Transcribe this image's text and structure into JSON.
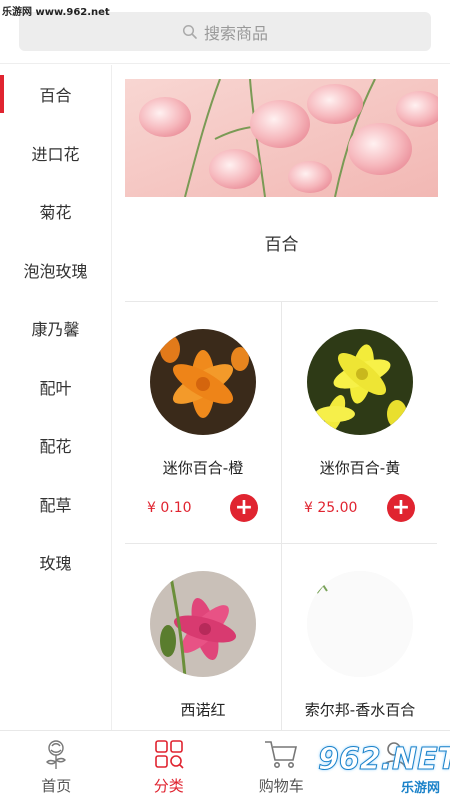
{
  "watermark": {
    "top_left": "乐游网 www.962.net",
    "bottom_right": "962.NET",
    "bottom_right_sub": "乐游网"
  },
  "search": {
    "placeholder": "搜索商品",
    "icon": "search-icon"
  },
  "sidebar": {
    "active_index": 0,
    "items": [
      {
        "label": "百合"
      },
      {
        "label": "进口花"
      },
      {
        "label": "菊花"
      },
      {
        "label": "泡泡玫瑰"
      },
      {
        "label": "康乃馨"
      },
      {
        "label": "配叶"
      },
      {
        "label": "配花"
      },
      {
        "label": "配草"
      },
      {
        "label": "玫瑰"
      }
    ]
  },
  "main": {
    "section_title": "百合",
    "products": [
      {
        "name": "迷你百合-橙",
        "price": "¥ 0.10",
        "add": "+",
        "image": "orange-lily-photo"
      },
      {
        "name": "迷你百合-黄",
        "price": "¥ 25.00",
        "add": "+",
        "image": "yellow-lily-photo"
      },
      {
        "name": "西诺红",
        "image": "pink-lily-photo"
      },
      {
        "name": "索尔邦-香水百合",
        "image": "loading-image-placeholder"
      }
    ]
  },
  "tabbar": {
    "active_index": 1,
    "tabs": [
      {
        "label": "首页",
        "icon": "flower-home-icon"
      },
      {
        "label": "分类",
        "icon": "category-grid-icon"
      },
      {
        "label": "购物车",
        "icon": "cart-icon"
      },
      {
        "label": "",
        "icon": "user-icon"
      }
    ]
  },
  "colors": {
    "accent": "#e02430",
    "search_bg": "#ededed",
    "divider": "#e8e8e8"
  }
}
